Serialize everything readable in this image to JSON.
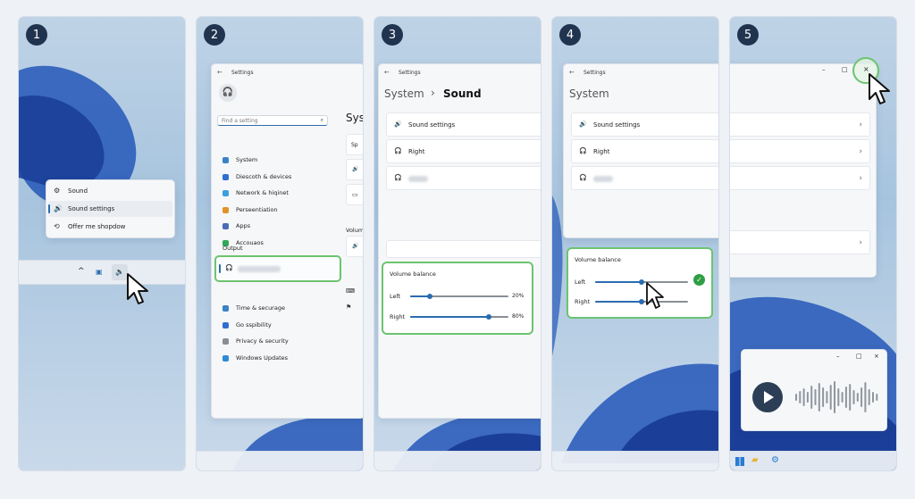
{
  "steps": [
    "1",
    "2",
    "3",
    "4",
    "5"
  ],
  "step1": {
    "menu": {
      "items": [
        {
          "label": "Sound",
          "icon": "gear-icon"
        },
        {
          "label": "Sound settings",
          "icon": "speaker-settings-icon"
        },
        {
          "label": "Offer me shopdow",
          "icon": "link-icon"
        }
      ]
    },
    "tray": {
      "chevron": "^",
      "icons": [
        "display-icon",
        "speaker-icon"
      ]
    }
  },
  "step2": {
    "title": "Settings",
    "search_placeholder": "Find a setting",
    "nav": [
      {
        "label": "System",
        "color": "#3b82c4"
      },
      {
        "label": "Diescoth & devices",
        "color": "#2f6fd1"
      },
      {
        "label": "Network & hiqinet",
        "color": "#3aa0e0"
      },
      {
        "label": "Perseentiation",
        "color": "#e0922b"
      },
      {
        "label": "Apps",
        "color": "#4a6bb8"
      },
      {
        "label": "Accouaos",
        "color": "#2fa85a"
      }
    ],
    "output_label": "Output",
    "nav2": [
      {
        "label": "Time & securage",
        "color": "#3b82c4"
      },
      {
        "label": "Go sspibility",
        "color": "#2f6fd1"
      },
      {
        "label": "Privacy & security",
        "color": "#8a8f96"
      },
      {
        "label": "Windows Updates",
        "color": "#2f8ad8"
      }
    ],
    "right_title": "Sys",
    "right_item": "Sp",
    "volume_label": "Volum"
  },
  "step3": {
    "title": "Settings",
    "breadcrumb_parent": "System",
    "breadcrumb_sep": "›",
    "breadcrumb_current": "Sound",
    "items": [
      "Sound settings",
      "Right"
    ],
    "balance": {
      "title": "Volume balance",
      "left_label": "Left",
      "left_value": 20,
      "left_text": "20%",
      "right_label": "Right",
      "right_value": 80,
      "right_text": "80%"
    }
  },
  "step4": {
    "title": "Settings",
    "heading": "System",
    "items": [
      "Sound settings",
      "Right"
    ],
    "balance": {
      "title": "Volume balance",
      "left_label": "Left",
      "left_value": 50,
      "right_label": "Right",
      "right_value": 50
    }
  },
  "step5": {
    "window_controls": [
      "–",
      "□",
      "×"
    ],
    "player_controls": [
      "–",
      "□",
      "×"
    ]
  }
}
